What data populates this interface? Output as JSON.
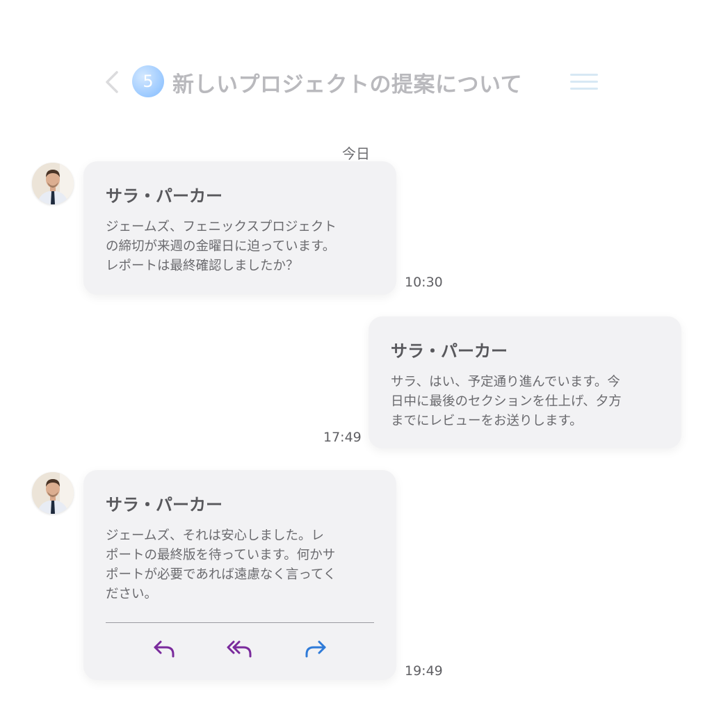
{
  "header": {
    "unread_count": "5",
    "title": "新しいプロジェクトの提案について"
  },
  "date_separator": "今日",
  "messages": [
    {
      "sender": "サラ・パーカー",
      "text": "ジェームズ、フェニックスプロジェクト\nの締切が来週の金曜日に迫っています。\nレポートは最終確認しましたか？",
      "time": "10:30",
      "direction": "incoming"
    },
    {
      "sender": "サラ・パーカー",
      "text": "サラ、はい、予定通り進んでいます。今\n日中に最後のセクションを仕上げ、夕方\nまでにレビューをお送りします。",
      "time": "17:49",
      "direction": "outgoing"
    },
    {
      "sender": "サラ・パーカー",
      "text": "ジェームズ、それは安心しました。レ\nポートの最終版を待っています。何かサ\nポートが必要であれば遠慮なく言ってく\nださい。",
      "time": "19:49",
      "direction": "incoming",
      "actions": [
        {
          "name": "reply-icon",
          "color": "#7a2a9c"
        },
        {
          "name": "reply-all-icon",
          "color": "#7a2a9c"
        },
        {
          "name": "forward-icon",
          "color": "#2f7bd8"
        }
      ]
    }
  ],
  "colors": {
    "bubble_bg": "#f2f2f4",
    "reply_accent": "#7a2a9c",
    "forward_accent": "#2f7bd8",
    "badge_blue": "#8fc3ff"
  }
}
